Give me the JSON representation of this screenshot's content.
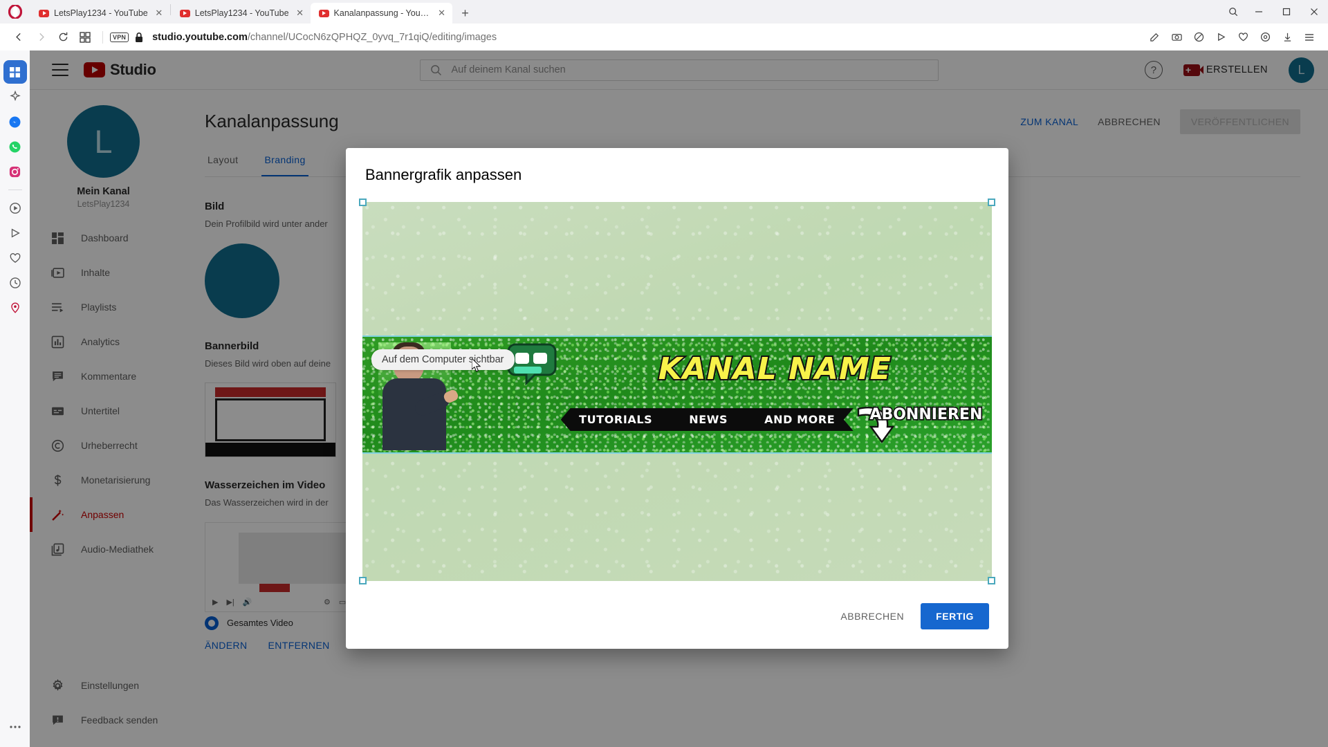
{
  "browser": {
    "name": "opera",
    "tabs": [
      {
        "title": "LetsPlay1234 - YouTube",
        "active": false
      },
      {
        "title": "LetsPlay1234 - YouTube",
        "active": false
      },
      {
        "title": "Kanalanpassung - YouTub",
        "active": true
      }
    ],
    "new_tab_label": "+",
    "url": "studio.youtube.com/channel/UCocN6zQPHQZ_0yvq_7r1qiQ/editing/images",
    "url_domain": "studio.youtube.com",
    "url_rest": "/channel/UCocN6zQPHQZ_0yvq_7r1qiQ/editing/images",
    "vpn_badge": "VPN",
    "window_controls": {
      "minimize": "—",
      "maximize": "☐",
      "close": "✕",
      "search": "⌕"
    }
  },
  "studio_header": {
    "logo_text": "Studio",
    "search_placeholder": "Auf deinem Kanal suchen",
    "search_value": "",
    "create_label": "ERSTELLEN",
    "help_label": "?",
    "avatar_letter": "L"
  },
  "sidebar": {
    "channel_title": "Mein Kanal",
    "channel_handle": "LetsPlay1234",
    "avatar_letter": "L",
    "items": [
      {
        "label": "Dashboard",
        "icon": "dashboard-icon",
        "active": false
      },
      {
        "label": "Inhalte",
        "icon": "video-icon",
        "active": false
      },
      {
        "label": "Playlists",
        "icon": "playlist-icon",
        "active": false
      },
      {
        "label": "Analytics",
        "icon": "analytics-icon",
        "active": false
      },
      {
        "label": "Kommentare",
        "icon": "comment-icon",
        "active": false
      },
      {
        "label": "Untertitel",
        "icon": "subtitles-icon",
        "active": false
      },
      {
        "label": "Urheberrecht",
        "icon": "copyright-icon",
        "active": false
      },
      {
        "label": "Monetarisierung",
        "icon": "dollar-icon",
        "active": false
      },
      {
        "label": "Anpassen",
        "icon": "magic-wand-icon",
        "active": true
      },
      {
        "label": "Audio-Mediathek",
        "icon": "music-library-icon",
        "active": false
      }
    ],
    "bottom_items": [
      {
        "label": "Einstellungen",
        "icon": "gear-icon"
      },
      {
        "label": "Feedback senden",
        "icon": "feedback-icon"
      }
    ]
  },
  "main": {
    "page_title": "Kanalanpassung",
    "tabs": [
      {
        "label": "Layout",
        "active": false
      },
      {
        "label": "Branding",
        "active": true
      }
    ],
    "top_actions": {
      "view_channel": "ZUM KANAL",
      "cancel": "ABBRECHEN",
      "publish": "VERÖFFENTLICHEN"
    },
    "sections": [
      {
        "heading": "Bild",
        "description": "Dein Profilbild wird unter ander"
      },
      {
        "heading": "Bannerbild",
        "description": "Dieses Bild wird oben auf deine"
      },
      {
        "heading": "Wasserzeichen im Video",
        "description": "Das Wasserzeichen wird in der"
      }
    ],
    "watermark": {
      "radio_label": "Gesamtes Video",
      "change": "ÄNDERN",
      "remove": "ENTFERNEN"
    }
  },
  "modal": {
    "title": "Bannergrafik anpassen",
    "cancel_label": "ABBRECHEN",
    "done_label": "FERTIG",
    "tooltip": "Auf dem Computer sichtbar",
    "banner": {
      "channel_name": "KANAL NAME",
      "ribbon_items": [
        "TUTORIALS",
        "NEWS",
        "AND MORE"
      ],
      "subscribe_text": "ABONNIEREN"
    }
  },
  "colors": {
    "yt_red": "#cc0000",
    "accent_blue": "#065fd4",
    "primary_button": "#1667cf",
    "avatar_teal": "#126e8e",
    "safe_area_outline": "#7fd2e0",
    "banner_yellow": "#f7f24a",
    "banner_green": "#2f9b24"
  }
}
